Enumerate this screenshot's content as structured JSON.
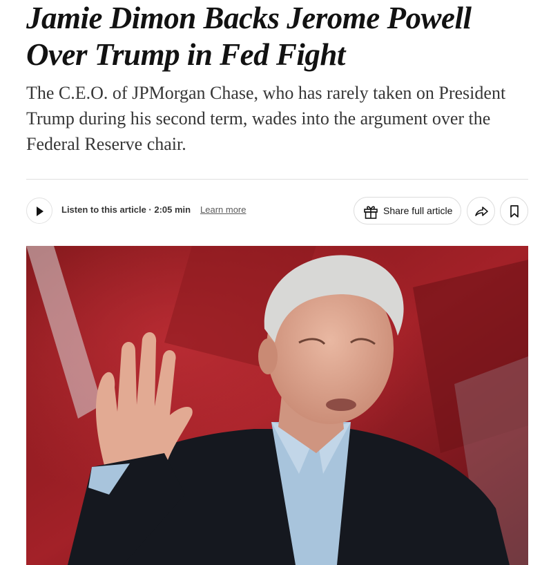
{
  "article": {
    "headline": "Jamie Dimon Backs Jerome Powell Over Trump in Fed Fight",
    "summary": "The C.E.O. of JPMorgan Chase, who has rarely taken on President Trump during his second term, wades into the argument over the Federal Reserve chair."
  },
  "toolbar": {
    "play_icon": "play-icon",
    "listen_label": "Listen to this article · 2:05 min",
    "learn_more_label": "Learn more",
    "share_icon": "gift-icon",
    "share_label": "Share full article",
    "forward_icon": "share-arrow-icon",
    "bookmark_icon": "bookmark-icon"
  },
  "photo": {
    "subject": "man-with-raised-hand-photo"
  },
  "colors": {
    "text": "#121212",
    "summary_text": "#363636",
    "border": "#dcdcdc",
    "photo_background": "#8a1c22"
  }
}
